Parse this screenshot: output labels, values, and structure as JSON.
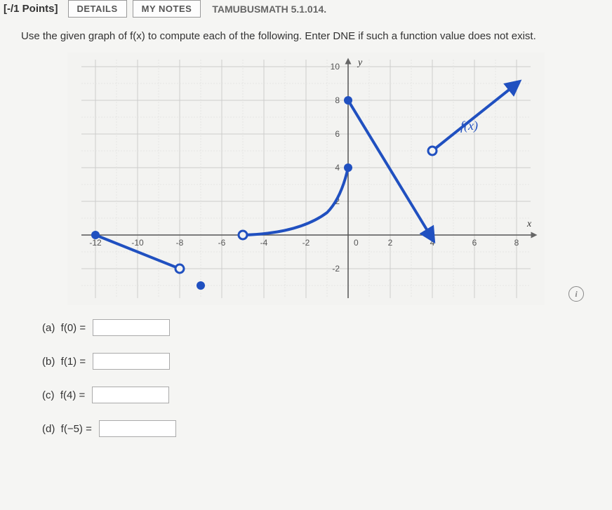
{
  "header": {
    "points": "[-/1 Points]",
    "details_btn": "DETAILS",
    "notes_btn": "MY NOTES",
    "assignment_ref": "TAMUBUSMATH 5.1.014."
  },
  "instruction": "Use the given graph of f(x) to compute each of the following. Enter DNE if such a function value does not exist.",
  "graph": {
    "axis_labels": {
      "x": "x",
      "y": "y"
    },
    "function_label": "f(x)",
    "x_ticks": [
      "-12",
      "-10",
      "-8",
      "-6",
      "-4",
      "-2",
      "0",
      "2",
      "4",
      "6",
      "8"
    ],
    "y_ticks": [
      "-2",
      "0",
      "2",
      "4",
      "6",
      "8",
      "10"
    ]
  },
  "questions": {
    "a": {
      "label": "(a)  f(0) = ",
      "value": ""
    },
    "b": {
      "label": "(b)  f(1) = ",
      "value": ""
    },
    "c": {
      "label": "(c)  f(4) = ",
      "value": ""
    },
    "d": {
      "label": "(d)  f(−5) = ",
      "value": ""
    }
  },
  "chart_data": {
    "type": "line",
    "title": "",
    "xlabel": "x",
    "ylabel": "y",
    "xlim": [
      -13,
      9
    ],
    "ylim": [
      -4,
      11
    ],
    "series": [
      {
        "name": "segment1",
        "points": [
          [
            -12,
            0
          ],
          [
            -8,
            -2
          ]
        ],
        "left_endpoint": "closed",
        "right_endpoint": "open"
      },
      {
        "name": "isolated_point",
        "points": [
          [
            -7,
            -3
          ]
        ],
        "style": "closed"
      },
      {
        "name": "segment2_curve",
        "points": [
          [
            -5,
            0
          ],
          [
            -4,
            0.2
          ],
          [
            -3,
            0.5
          ],
          [
            -2,
            1
          ],
          [
            -1,
            2
          ],
          [
            0,
            4
          ]
        ],
        "left_endpoint": "open",
        "right_endpoint": "closed"
      },
      {
        "name": "segment3",
        "points": [
          [
            0,
            8
          ],
          [
            4,
            0
          ]
        ],
        "left_endpoint": "closed",
        "right_endpoint": "arrow"
      },
      {
        "name": "segment4",
        "points": [
          [
            4,
            5
          ],
          [
            8,
            9
          ]
        ],
        "left_endpoint": "open",
        "right_endpoint": "arrow"
      }
    ]
  }
}
